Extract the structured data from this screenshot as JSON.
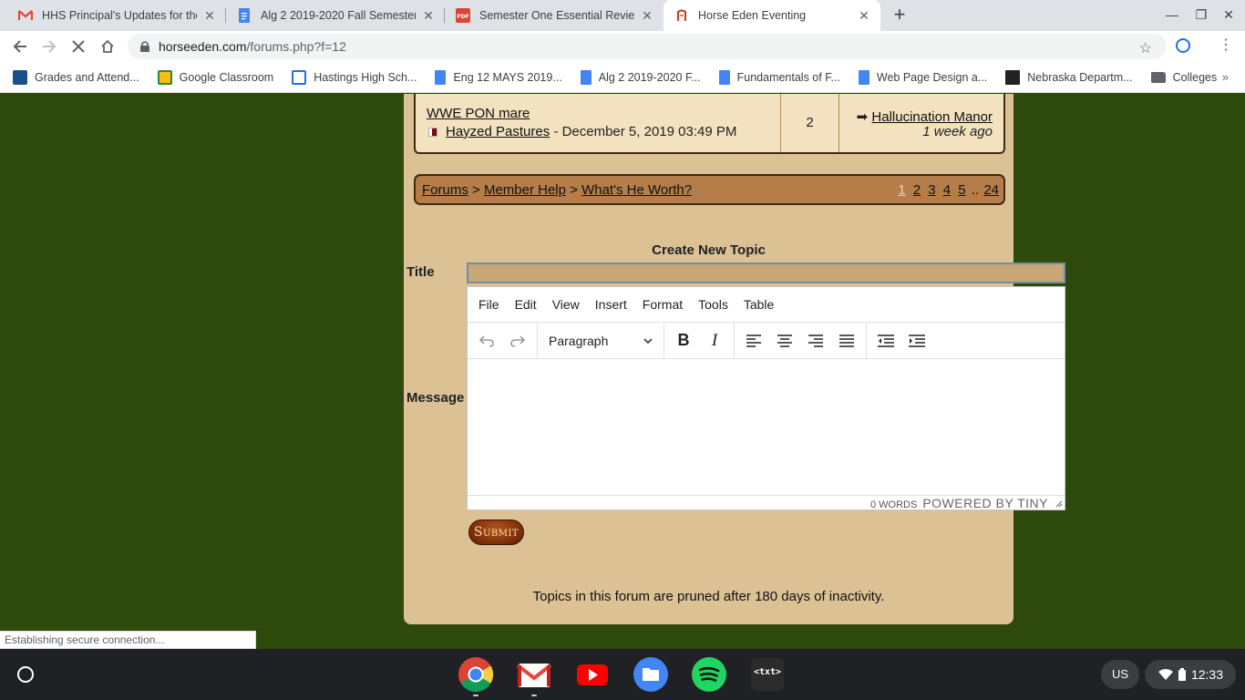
{
  "browser": {
    "tabs": [
      {
        "title": "HHS Principal's Updates for the",
        "icon": "gmail-icon"
      },
      {
        "title": "Alg 2 2019-2020 Fall Semester -",
        "icon": "docs-icon"
      },
      {
        "title": "Semester One Essential Review K",
        "icon": "pdf-icon"
      },
      {
        "title": "Horse Eden Eventing",
        "icon": "horseeden-icon"
      }
    ],
    "url_host": "horseeden.com",
    "url_path": "/forums.php?f=12",
    "bookmarks": [
      "Grades and Attend...",
      "Google Classroom",
      "Hastings High Sch...",
      "Eng 12 MAYS 2019...",
      "Alg 2 2019-2020 F...",
      "Fundamentals of F...",
      "Web Page Design a...",
      "Nebraska Departm...",
      "Colleges"
    ],
    "status_popup": "Establishing secure connection..."
  },
  "forum": {
    "topic": {
      "title": "WWE PON mare",
      "author": "Hayzed Pastures",
      "posted": "- December 5, 2019 03:49 PM",
      "replies": "2",
      "last_poster": "Hallucination Manor",
      "last_time": "1 week ago"
    },
    "breadcrumb": {
      "forums": "Forums",
      "sep1": ">",
      "member_help": "Member Help",
      "sep2": ">",
      "current": "What's He Worth?"
    },
    "pages": {
      "current": "1",
      "links": [
        "2",
        "3",
        "4",
        "5"
      ],
      "ellipsis": "..",
      "last": "24"
    },
    "create_topic": {
      "heading": "Create New Topic",
      "title_label": "Title",
      "title_value": "",
      "message_label": "Message"
    },
    "editor": {
      "menus": [
        "File",
        "Edit",
        "View",
        "Insert",
        "Format",
        "Tools",
        "Table"
      ],
      "block_format": "Paragraph",
      "word_count": "0 WORDS",
      "powered_by": "POWERED BY TINY"
    },
    "submit_label": "Submit",
    "prune_note": "Topics in this forum are pruned after 180 days of inactivity."
  },
  "shelf": {
    "apps": [
      "chrome-icon",
      "gmail-icon",
      "youtube-icon",
      "files-icon",
      "spotify-icon",
      "text-editor-icon"
    ],
    "text_app_label": "<txt>",
    "ime": "US",
    "time": "12:33"
  },
  "colors": {
    "page_background": "#2d4a0c",
    "forum_panel": "#dcc195",
    "breadcrumb_bar": "#b47d4a",
    "title_input": "#c9a777",
    "submit_button": "#7a2d0a"
  }
}
